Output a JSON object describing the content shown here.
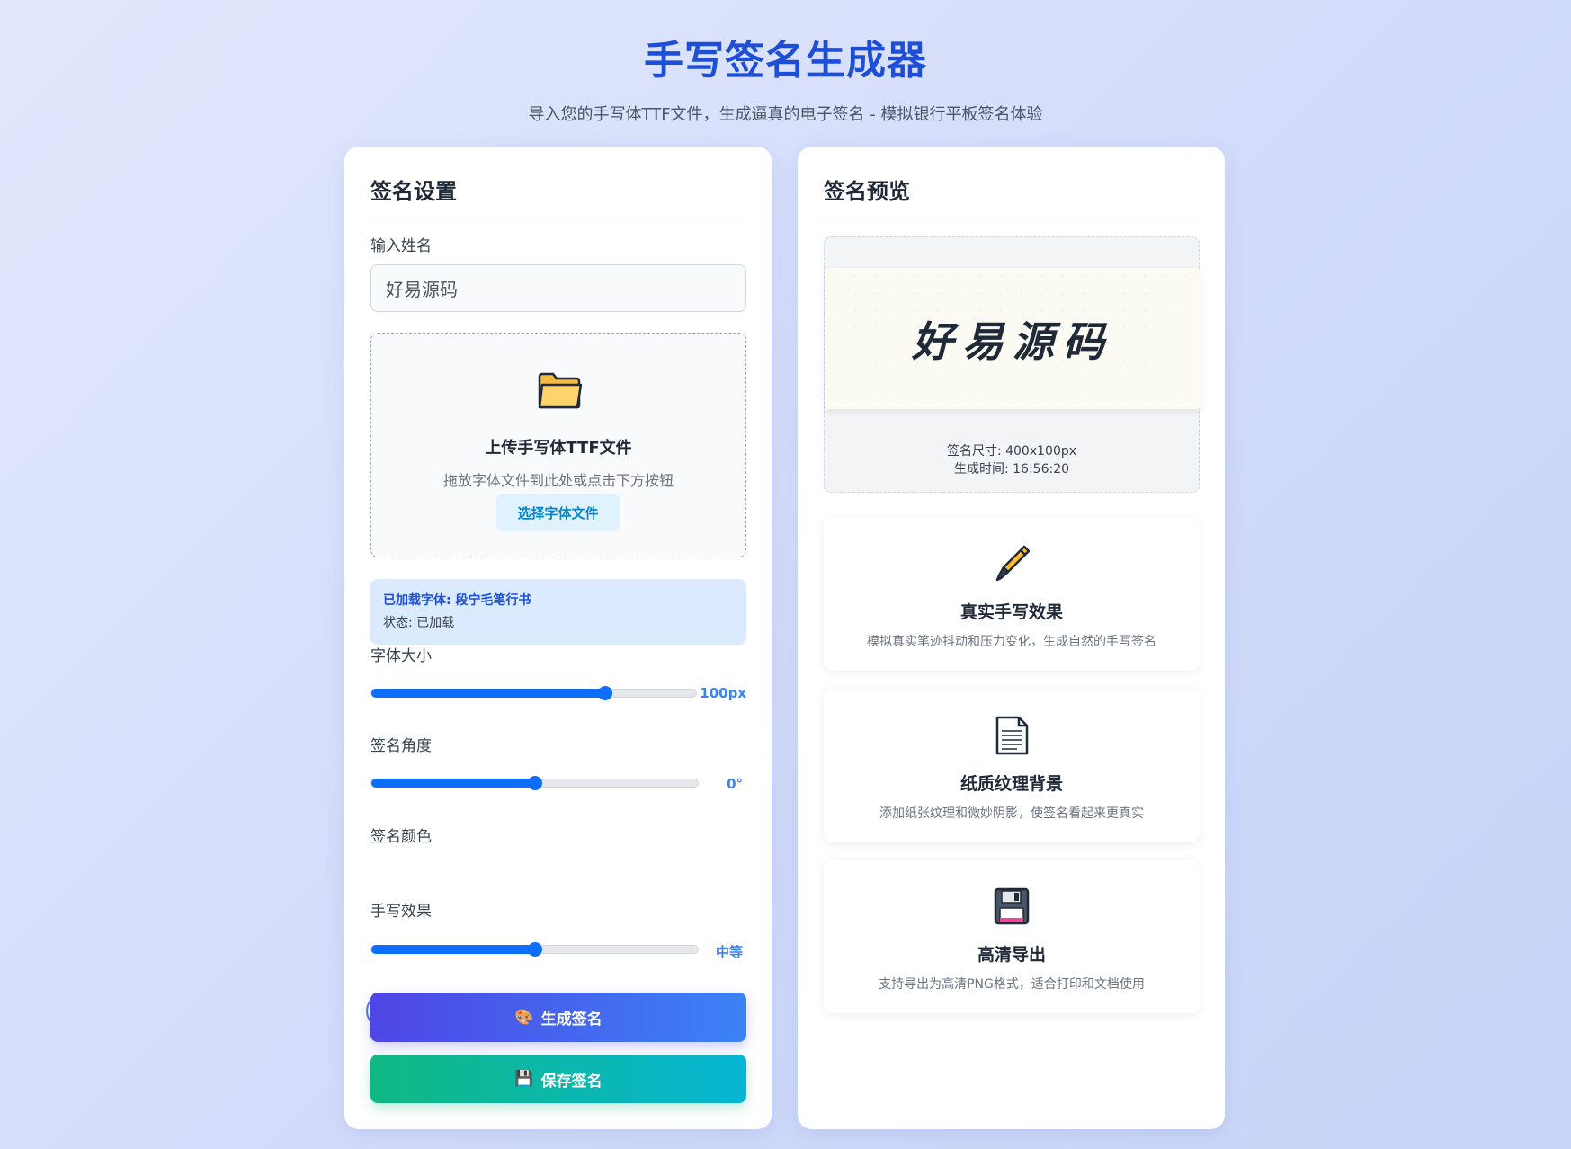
{
  "header": {
    "title": "手写签名生成器",
    "subtitle": "导入您的手写体TTF文件，生成逼真的电子签名 - 模拟银行平板签名体验"
  },
  "settings": {
    "title": "签名设置",
    "name_label": "输入姓名",
    "name_value": "好易源码",
    "upload": {
      "icon": "folder-icon",
      "title": "上传手写体TTF文件",
      "hint": "拖放字体文件到此处或点击下方按钮",
      "button": "选择字体文件"
    },
    "font_info": {
      "loaded": "已加载字体: 段宁毛笔行书",
      "status": "状态: 已加载"
    },
    "font_size": {
      "label": "字体大小",
      "value_text": "100px",
      "fraction": 0.72
    },
    "angle": {
      "label": "签名角度",
      "value_text": "0°",
      "fraction": 0.5
    },
    "color": {
      "label": "签名颜色",
      "swatches": [
        "#1e293b",
        "#dc2626",
        "#2563eb",
        "#059669",
        "#7c3aed"
      ],
      "selected": 0
    },
    "effect": {
      "label": "手写效果",
      "value_text": "中等",
      "fraction": 0.5
    },
    "generate_label": "生成签名",
    "generate_icon": "palette-icon",
    "save_label": "保存签名",
    "save_icon": "floppy-disk-icon"
  },
  "preview": {
    "title": "签名预览",
    "signature_text": "好易源码",
    "size_text": "签名尺寸: 400x100px",
    "time_text": "生成时间: 16:56:20"
  },
  "features": [
    {
      "icon": "fountain-pen-icon",
      "title": "真实手写效果",
      "desc": "模拟真实笔迹抖动和压力变化，生成自然的手写签名"
    },
    {
      "icon": "document-icon",
      "title": "纸质纹理背景",
      "desc": "添加纸张纹理和微妙阴影，使签名看起来更真实"
    },
    {
      "icon": "floppy-disk-icon",
      "title": "高清导出",
      "desc": "支持导出为高清PNG格式，适合打印和文档使用"
    }
  ]
}
